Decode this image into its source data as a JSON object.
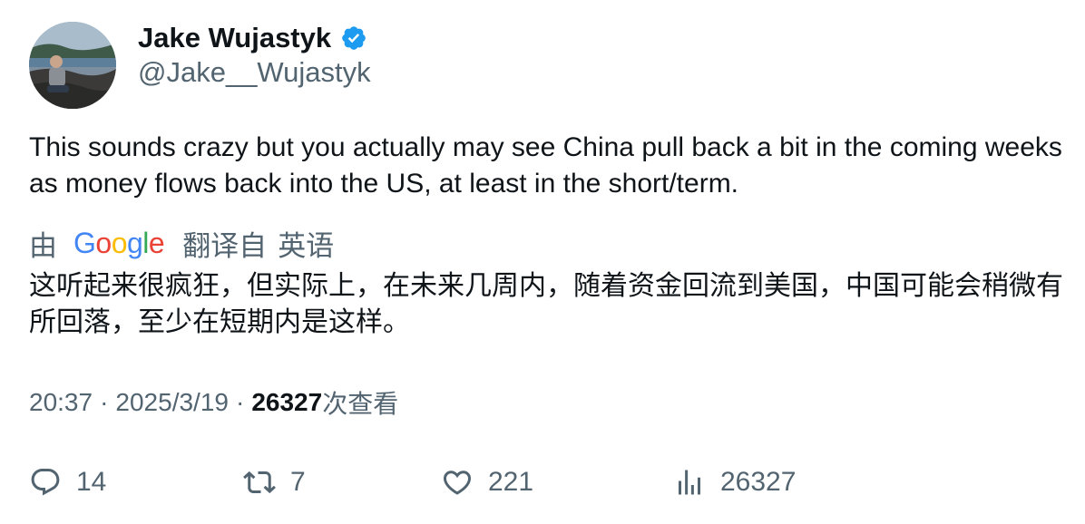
{
  "author": {
    "display_name": "Jake Wujastyk",
    "handle": "@Jake__Wujastyk",
    "verified": true,
    "verified_color": "#1d9bf0"
  },
  "tweet": {
    "text": "This sounds crazy but you actually may see China pull back a bit in the coming weeks as money flows back into the US, at least in the short/term."
  },
  "translation": {
    "by_label": "由",
    "provider_letters": [
      "G",
      "o",
      "o",
      "g",
      "l",
      "e"
    ],
    "from_label": "翻译自",
    "language": "英语",
    "text": "这听起来很疯狂，但实际上，在未来几周内，随着资金回流到美国，中国可能会稍微有所回落，至少在短期内是这样。"
  },
  "meta": {
    "time": "20:37",
    "separator": "·",
    "date": "2025/3/19",
    "views_count": "26327",
    "views_label": "次查看"
  },
  "actions": {
    "reply": {
      "icon": "reply-icon",
      "count": "14"
    },
    "retweet": {
      "icon": "retweet-icon",
      "count": "7"
    },
    "like": {
      "icon": "heart-icon",
      "count": "221"
    },
    "views": {
      "icon": "views-chart-icon",
      "count": "26327"
    }
  },
  "colors": {
    "text_primary": "#0f1419",
    "text_secondary": "#536471",
    "google_blue": "#4285F4",
    "google_red": "#EA4335",
    "google_yellow": "#FBBC05",
    "google_green": "#34A853"
  }
}
